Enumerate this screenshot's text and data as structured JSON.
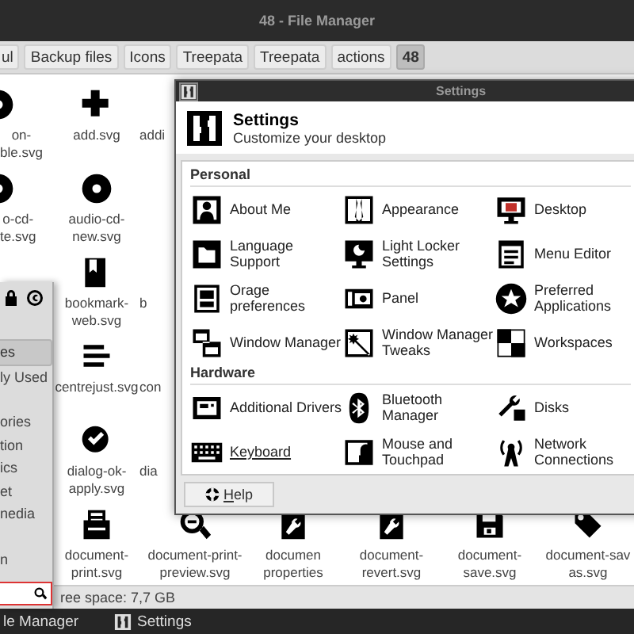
{
  "window": {
    "title": "48 - File Manager"
  },
  "path_bar": [
    {
      "label": "ul",
      "selected": false
    },
    {
      "label": "Backup files",
      "selected": false
    },
    {
      "label": "Icons",
      "selected": false
    },
    {
      "label": "Treepata",
      "selected": false
    },
    {
      "label": "Treepata",
      "selected": false
    },
    {
      "label": "actions",
      "selected": false
    },
    {
      "label": "48",
      "selected": true
    }
  ],
  "files": [
    [
      {
        "lines": [
          "on-",
          "ble.svg"
        ]
      },
      {
        "lines": [
          "add.svg"
        ]
      },
      {
        "lines": [
          "addi"
        ]
      }
    ],
    [
      {
        "lines": [
          "o-cd-",
          "te.svg"
        ]
      },
      {
        "lines": [
          "audio-cd-",
          "new.svg"
        ]
      }
    ],
    [
      {
        "lines": [
          "bookmark-",
          "web.svg"
        ]
      },
      {
        "lines": [
          "b"
        ]
      }
    ],
    [
      {
        "lines": [
          "centrejust.svg"
        ]
      },
      {
        "lines": [
          "con"
        ]
      }
    ],
    [
      {
        "lines": [
          "dialog-ok-",
          "apply.svg"
        ]
      },
      {
        "lines": [
          "dia"
        ]
      }
    ],
    [
      {
        "lines": [
          "document-",
          "print.svg"
        ]
      },
      {
        "lines": [
          "document-print-",
          "preview.svg"
        ]
      },
      {
        "lines": [
          "documen",
          "properties"
        ]
      },
      {
        "lines": [
          "document-",
          "revert.svg"
        ]
      },
      {
        "lines": [
          "document-",
          "save.svg"
        ]
      },
      {
        "lines": [
          "document-sav",
          "as.svg"
        ]
      }
    ]
  ],
  "status_bar": "ree space: 7,7 GB",
  "menu": {
    "groups": [
      [
        {
          "label": "es",
          "selected": true
        },
        {
          "label": "ly Used",
          "selected": false
        }
      ],
      [
        {
          "label": "ories",
          "selected": false
        },
        {
          "label": "tion",
          "selected": false
        },
        {
          "label": "ics",
          "selected": false
        },
        {
          "label": "et",
          "selected": false
        },
        {
          "label": "nedia",
          "selected": false
        }
      ],
      [
        {
          "label": "n",
          "selected": false
        }
      ]
    ]
  },
  "dialog": {
    "title": "Settings",
    "header_title": "Settings",
    "header_subtitle": "Customize your desktop",
    "sections": [
      {
        "title": "Personal",
        "items": [
          {
            "label": "About Me",
            "hovered": false
          },
          {
            "label": "Appearance",
            "hovered": false
          },
          {
            "label": "Desktop",
            "hovered": false
          },
          {
            "label": "Language Support",
            "hovered": false
          },
          {
            "label": "Light Locker Settings",
            "hovered": false
          },
          {
            "label": "Menu Editor",
            "hovered": false
          },
          {
            "label": "Orage preferences",
            "hovered": false
          },
          {
            "label": "Panel",
            "hovered": false
          },
          {
            "label": "Preferred Applications",
            "hovered": false
          },
          {
            "label": "Window Manager",
            "hovered": false
          },
          {
            "label": "Window Manager Tweaks",
            "hovered": false
          },
          {
            "label": "Workspaces",
            "hovered": false
          }
        ]
      },
      {
        "title": "Hardware",
        "items": [
          {
            "label": "Additional Drivers",
            "hovered": false
          },
          {
            "label": "Bluetooth Manager",
            "hovered": false
          },
          {
            "label": "Disks",
            "hovered": false
          },
          {
            "label": "Keyboard",
            "hovered": true
          },
          {
            "label": "Mouse and Touchpad",
            "hovered": false
          },
          {
            "label": "Network Connections",
            "hovered": false
          }
        ]
      }
    ],
    "help_button": "Help"
  },
  "taskbar": [
    "le Manager",
    "Settings"
  ]
}
